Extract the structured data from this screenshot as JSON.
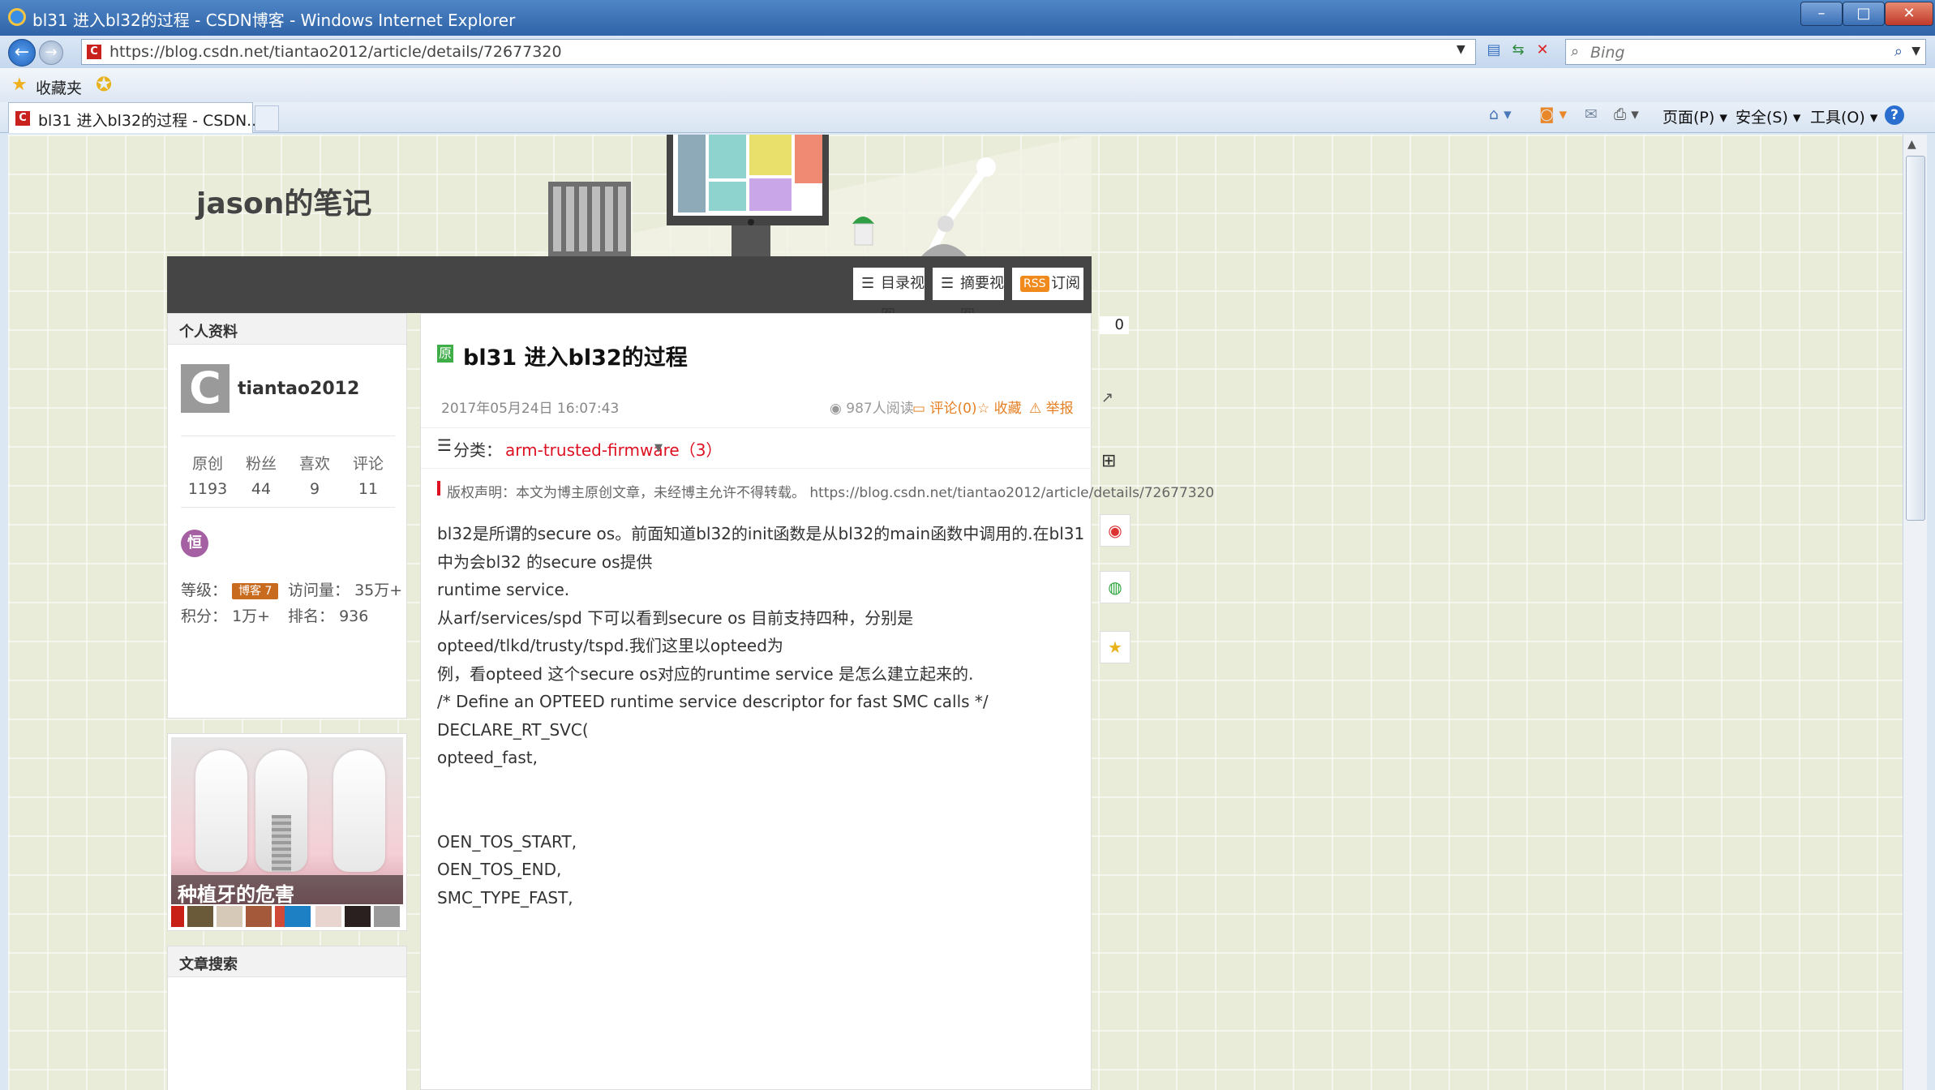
{
  "browser": {
    "window_title": "bl31 进入bl32的过程 - CSDN博客 - Windows Internet Explorer",
    "url": "https://blog.csdn.net/tiantao2012/article/details/72677320",
    "search_placeholder": "Bing",
    "favorites_label": "收藏夹",
    "tab_title": "bl31 进入bl32的过程 - CSDN...",
    "menus": {
      "page": "页面(P) ▾",
      "safety": "安全(S) ▾",
      "tools": "工具(O) ▾",
      "help": "?"
    }
  },
  "blog": {
    "name": "jason的笔记",
    "toolbar": {
      "dir_view": "目录视图",
      "summary_view": "摘要视图",
      "rss_badge": "RSS",
      "subscribe": "订阅"
    }
  },
  "profile": {
    "heading": "个人资料",
    "username": "tiantao2012",
    "avatar_letter": "C",
    "stats": [
      {
        "label": "原创",
        "value": "1193"
      },
      {
        "label": "粉丝",
        "value": "44"
      },
      {
        "label": "喜欢",
        "value": "9"
      },
      {
        "label": "评论",
        "value": "11"
      }
    ],
    "level_label": "等级：",
    "level_badge": "博客 7",
    "visits_label": "访问量：",
    "visits_value": "35万+",
    "points_label": "积分：",
    "points_value": "1万+",
    "rank_label": "排名：",
    "rank_value": "936"
  },
  "ad": {
    "caption": "种植牙的危害"
  },
  "search_panel": {
    "heading": "文章搜索"
  },
  "article": {
    "badge": "原",
    "title": "bl31 进入bl32的过程",
    "date": "2017年05月24日 16:07:43",
    "reads": "987人阅读",
    "comments": "评论(0)",
    "favorite": "收藏",
    "report": "举报",
    "category_label": "分类：",
    "category_link": "arm-trusted-firmware（3）",
    "copyright": "版权声明：本文为博主原创文章，未经博主允许不得转载。 https://blog.csdn.net/tiantao2012/article/details/72677320",
    "body": [
      "bl32是所谓的secure os。前面知道bl32的init函数是从bl32的main函数中调用的.在bl31中为会bl32 的secure os提供",
      "runtime service.",
      "从arf/services/spd 下可以看到secure os 目前支持四种，分别是opteed/tlkd/trusty/tspd.我们这里以opteed为",
      "例，看opteed 这个secure os对应的runtime service 是怎么建立起来的.",
      "/* Define an OPTEED runtime service descriptor for fast SMC calls */",
      "DECLARE_RT_SVC(",
      "opteed_fast,",
      "",
      "",
      "OEN_TOS_START,",
      "OEN_TOS_END,",
      "SMC_TYPE_FAST,"
    ]
  },
  "right_widgets": {
    "counter": "0"
  }
}
